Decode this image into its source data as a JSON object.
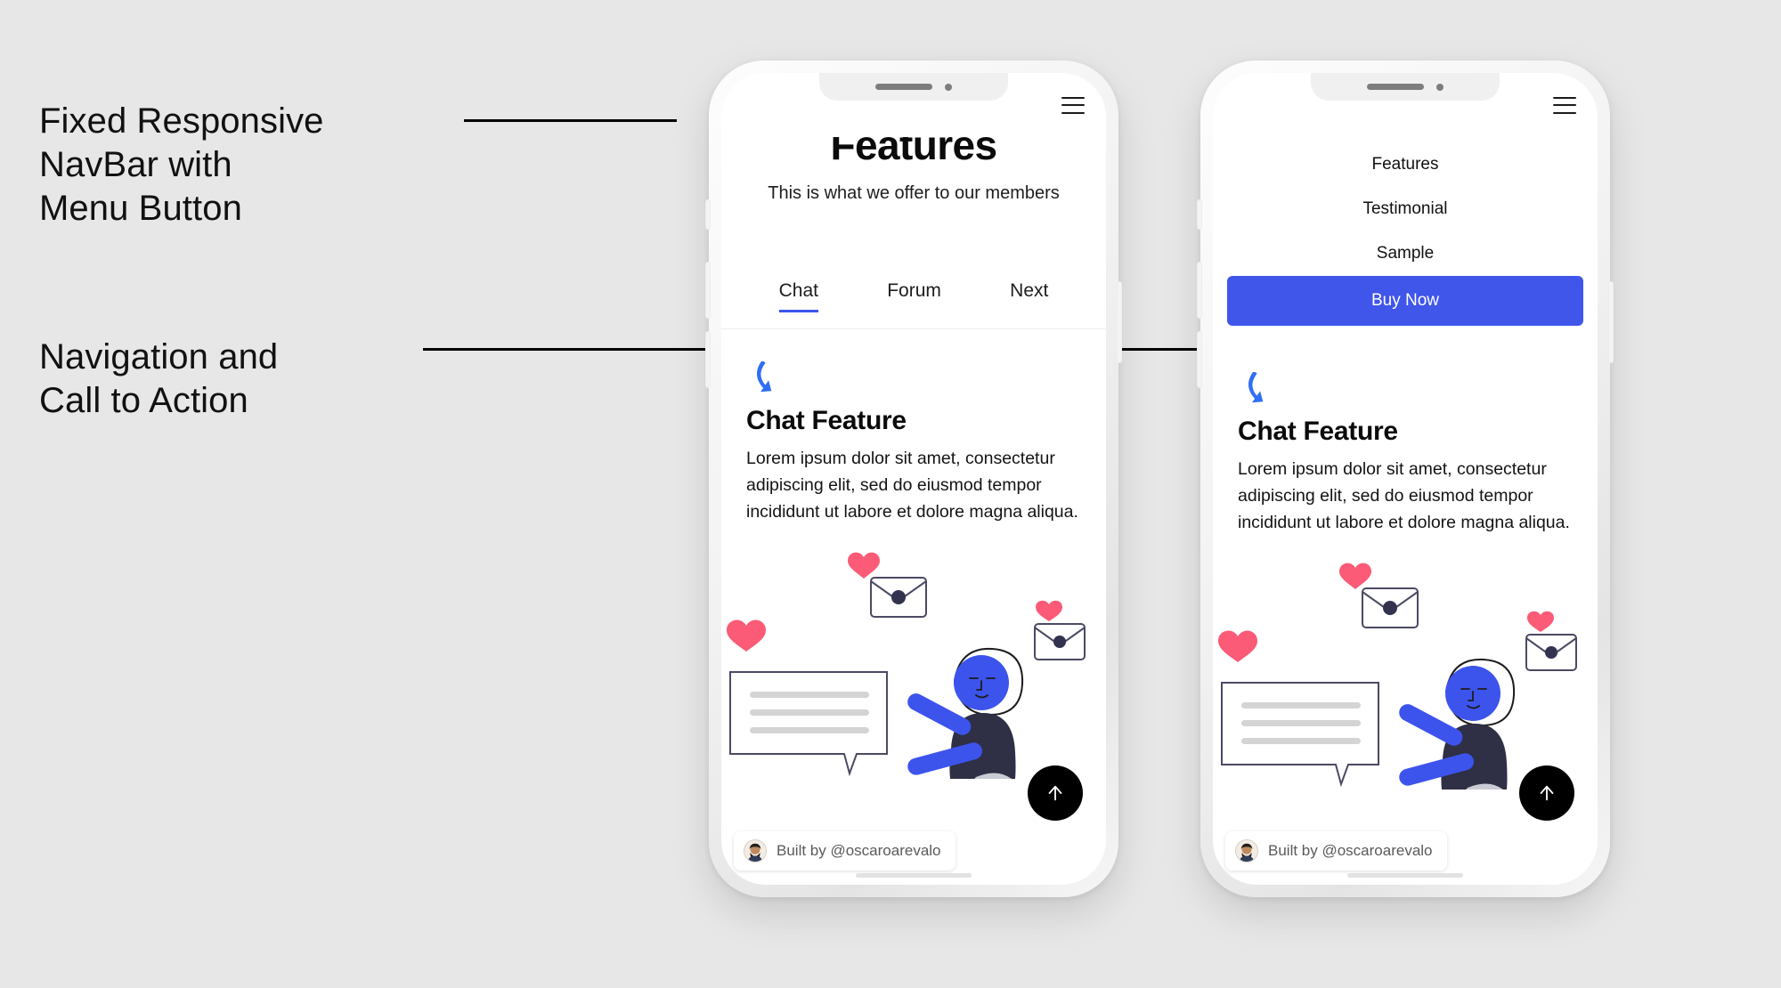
{
  "annotations": [
    {
      "id": "a1",
      "text": "Fixed Responsive\nNavBar with\nMenu Button"
    },
    {
      "id": "a2",
      "text": "Navigation and\nCall to Action"
    }
  ],
  "colors": {
    "page_background": "#e7e7e7",
    "accent_blue": "#4055ea",
    "tab_underline": "#3c54ec",
    "heart_pink": "#fb5b77",
    "dark_navy": "#333350",
    "fab_black": "#000000"
  },
  "phone_one": {
    "label": "phone-mockup-closed-menu",
    "navbar": {
      "menu_icon": "hamburger-icon"
    },
    "hero": {
      "title": "Features",
      "subtitle": "This is what we offer to our members"
    },
    "tabs": [
      {
        "label": "Chat",
        "active": true
      },
      {
        "label": "Forum",
        "active": false
      },
      {
        "label": "Next",
        "active": false
      }
    ],
    "feature": {
      "icon": "phone-call-icon",
      "title": "Chat Feature",
      "body": "Lorem ipsum dolor sit amet, consectetur adipiscing elit, sed do eiusmod tempor incididunt ut labore et dolore magna aliqua."
    },
    "fab": {
      "icon": "arrow-up-icon"
    },
    "credit": {
      "avatar": "user-avatar",
      "text": "Built by @oscaroarevalo"
    }
  },
  "phone_two": {
    "label": "phone-mockup-open-menu",
    "navbar": {
      "menu_icon": "hamburger-icon"
    },
    "menu": {
      "items": [
        {
          "label": "Features"
        },
        {
          "label": "Testimonial"
        },
        {
          "label": "Sample"
        }
      ],
      "cta_label": "Buy Now"
    },
    "feature": {
      "icon": "phone-call-icon",
      "title": "Chat Feature",
      "body": "Lorem ipsum dolor sit amet, consectetur adipiscing elit, sed do eiusmod tempor incididunt ut labore et dolore magna aliqua."
    },
    "fab": {
      "icon": "arrow-up-icon"
    },
    "credit": {
      "avatar": "user-avatar",
      "text": "Built by @oscaroarevalo"
    }
  }
}
